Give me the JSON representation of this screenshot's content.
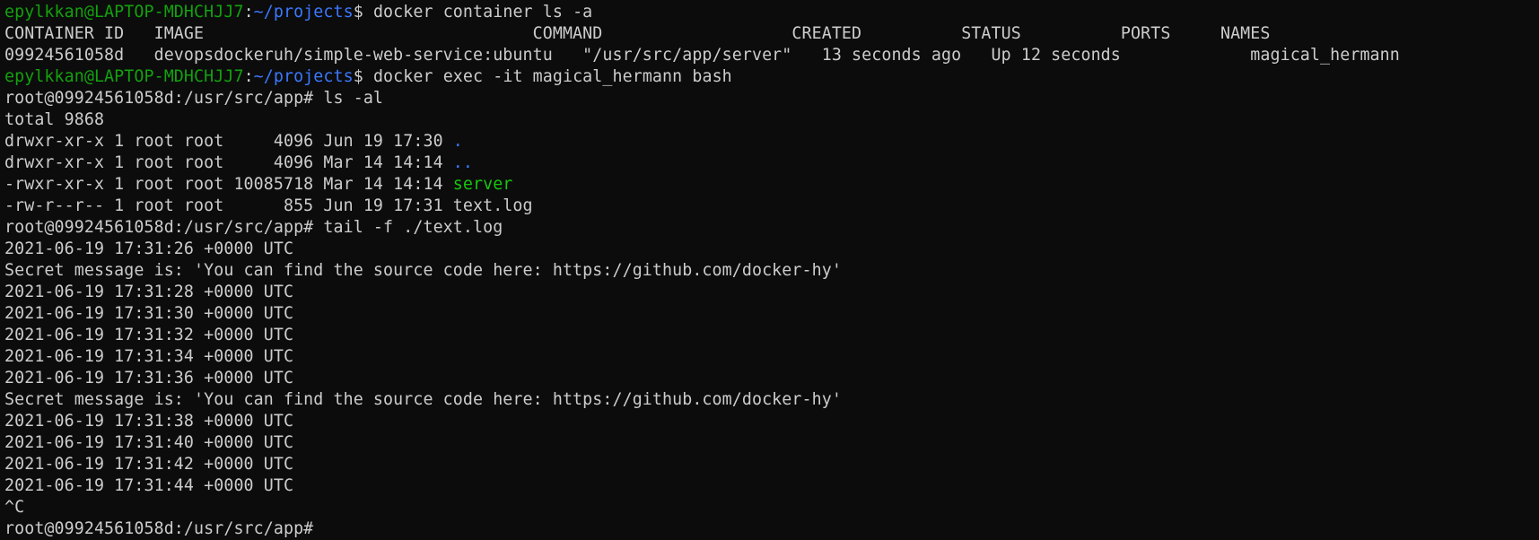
{
  "colors": {
    "background": "#0c0c0c",
    "foreground": "#cccccc",
    "user_host": "#13a10e",
    "path": "#3b78ff",
    "directory": "#3b78ff",
    "executable": "#16c60c"
  },
  "prompt": {
    "user_host": "epylkkan@LAPTOP-MDHCHJJ7",
    "path": "~/projects",
    "symbol": "$ "
  },
  "root_prompt": "root@09924561058d:/usr/src/app# ",
  "commands": {
    "docker_ls": "docker container ls -a",
    "docker_exec": "docker exec -it magical_hermann bash",
    "ls": "ls -al",
    "tail": "tail -f ./text.log"
  },
  "container_table": {
    "header": "CONTAINER ID   IMAGE                                 COMMAND                   CREATED          STATUS          PORTS     NAMES",
    "row": "09924561058d   devopsdockeruh/simple-web-service:ubuntu   \"/usr/src/app/server\"   13 seconds ago   Up 12 seconds             magical_hermann"
  },
  "listing": {
    "total": "total 9868",
    "entries": [
      {
        "meta": "drwxr-xr-x 1 root root     4096 Jun 19 17:30 ",
        "name": "."
      },
      {
        "meta": "drwxr-xr-x 1 root root     4096 Mar 14 14:14 ",
        "name": ".."
      },
      {
        "meta": "-rwxr-xr-x 1 root root 10085718 Mar 14 14:14 ",
        "name": "server"
      },
      {
        "meta": "-rw-r--r-- 1 root root      855 Jun 19 17:31 ",
        "name": "text.log"
      }
    ]
  },
  "log_lines": [
    "2021-06-19 17:31:26 +0000 UTC",
    "Secret message is: 'You can find the source code here: https://github.com/docker-hy'",
    "2021-06-19 17:31:28 +0000 UTC",
    "2021-06-19 17:31:30 +0000 UTC",
    "2021-06-19 17:31:32 +0000 UTC",
    "2021-06-19 17:31:34 +0000 UTC",
    "2021-06-19 17:31:36 +0000 UTC",
    "Secret message is: 'You can find the source code here: https://github.com/docker-hy'",
    "2021-06-19 17:31:38 +0000 UTC",
    "2021-06-19 17:31:40 +0000 UTC",
    "2021-06-19 17:31:42 +0000 UTC",
    "2021-06-19 17:31:44 +0000 UTC"
  ],
  "interrupt": "^C"
}
